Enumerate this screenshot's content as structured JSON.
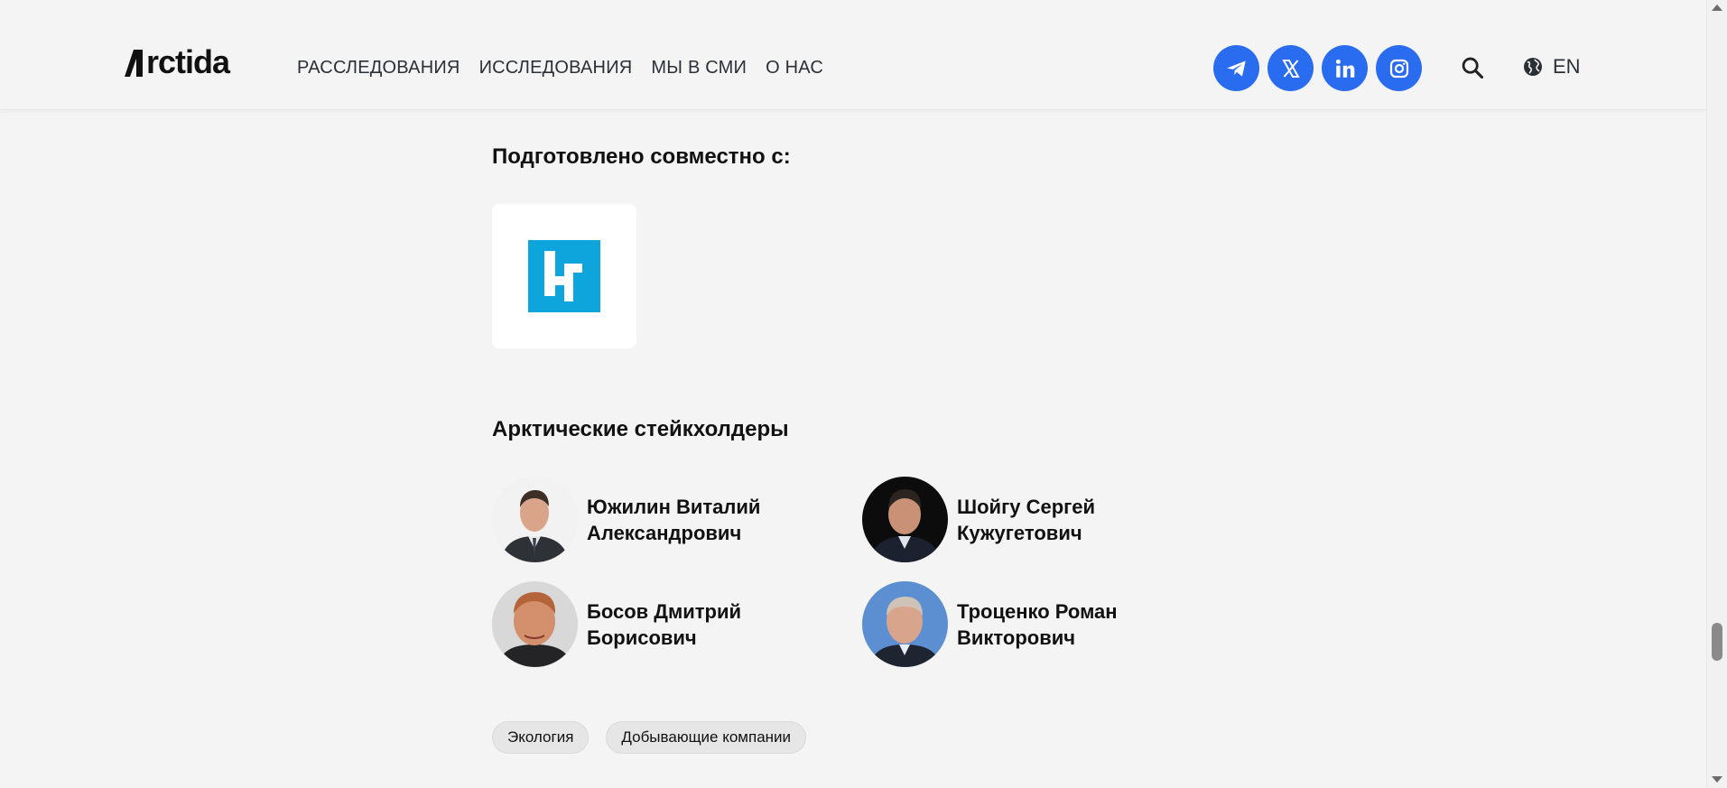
{
  "header": {
    "logo_text": "rctida",
    "nav": [
      {
        "label": "РАССЛЕДОВАНИЯ"
      },
      {
        "label": "ИССЛЕДОВАНИЯ"
      },
      {
        "label": "МЫ В СМИ"
      },
      {
        "label": "О НАС"
      }
    ],
    "socials": [
      "telegram-icon",
      "x-icon",
      "linkedin-icon",
      "instagram-icon"
    ],
    "lang_label": "EN",
    "accent_color": "#2a6cf0"
  },
  "partners": {
    "title": "Подготовлено совместно с:",
    "logo_color": "#0ea5dd"
  },
  "stakeholders": {
    "title": "Арктические стейкхолдеры",
    "people": [
      {
        "first_line": "Южилин Виталий",
        "second_line": "Александрович"
      },
      {
        "first_line": "Шойгу Сергей",
        "second_line": "Кужугетович"
      },
      {
        "first_line": "Босов Дмитрий",
        "second_line": "Борисович"
      },
      {
        "first_line": "Троценко Роман",
        "second_line": "Викторович"
      }
    ]
  },
  "tags": [
    {
      "label": "Экология"
    },
    {
      "label": "Добывающие компании"
    }
  ]
}
